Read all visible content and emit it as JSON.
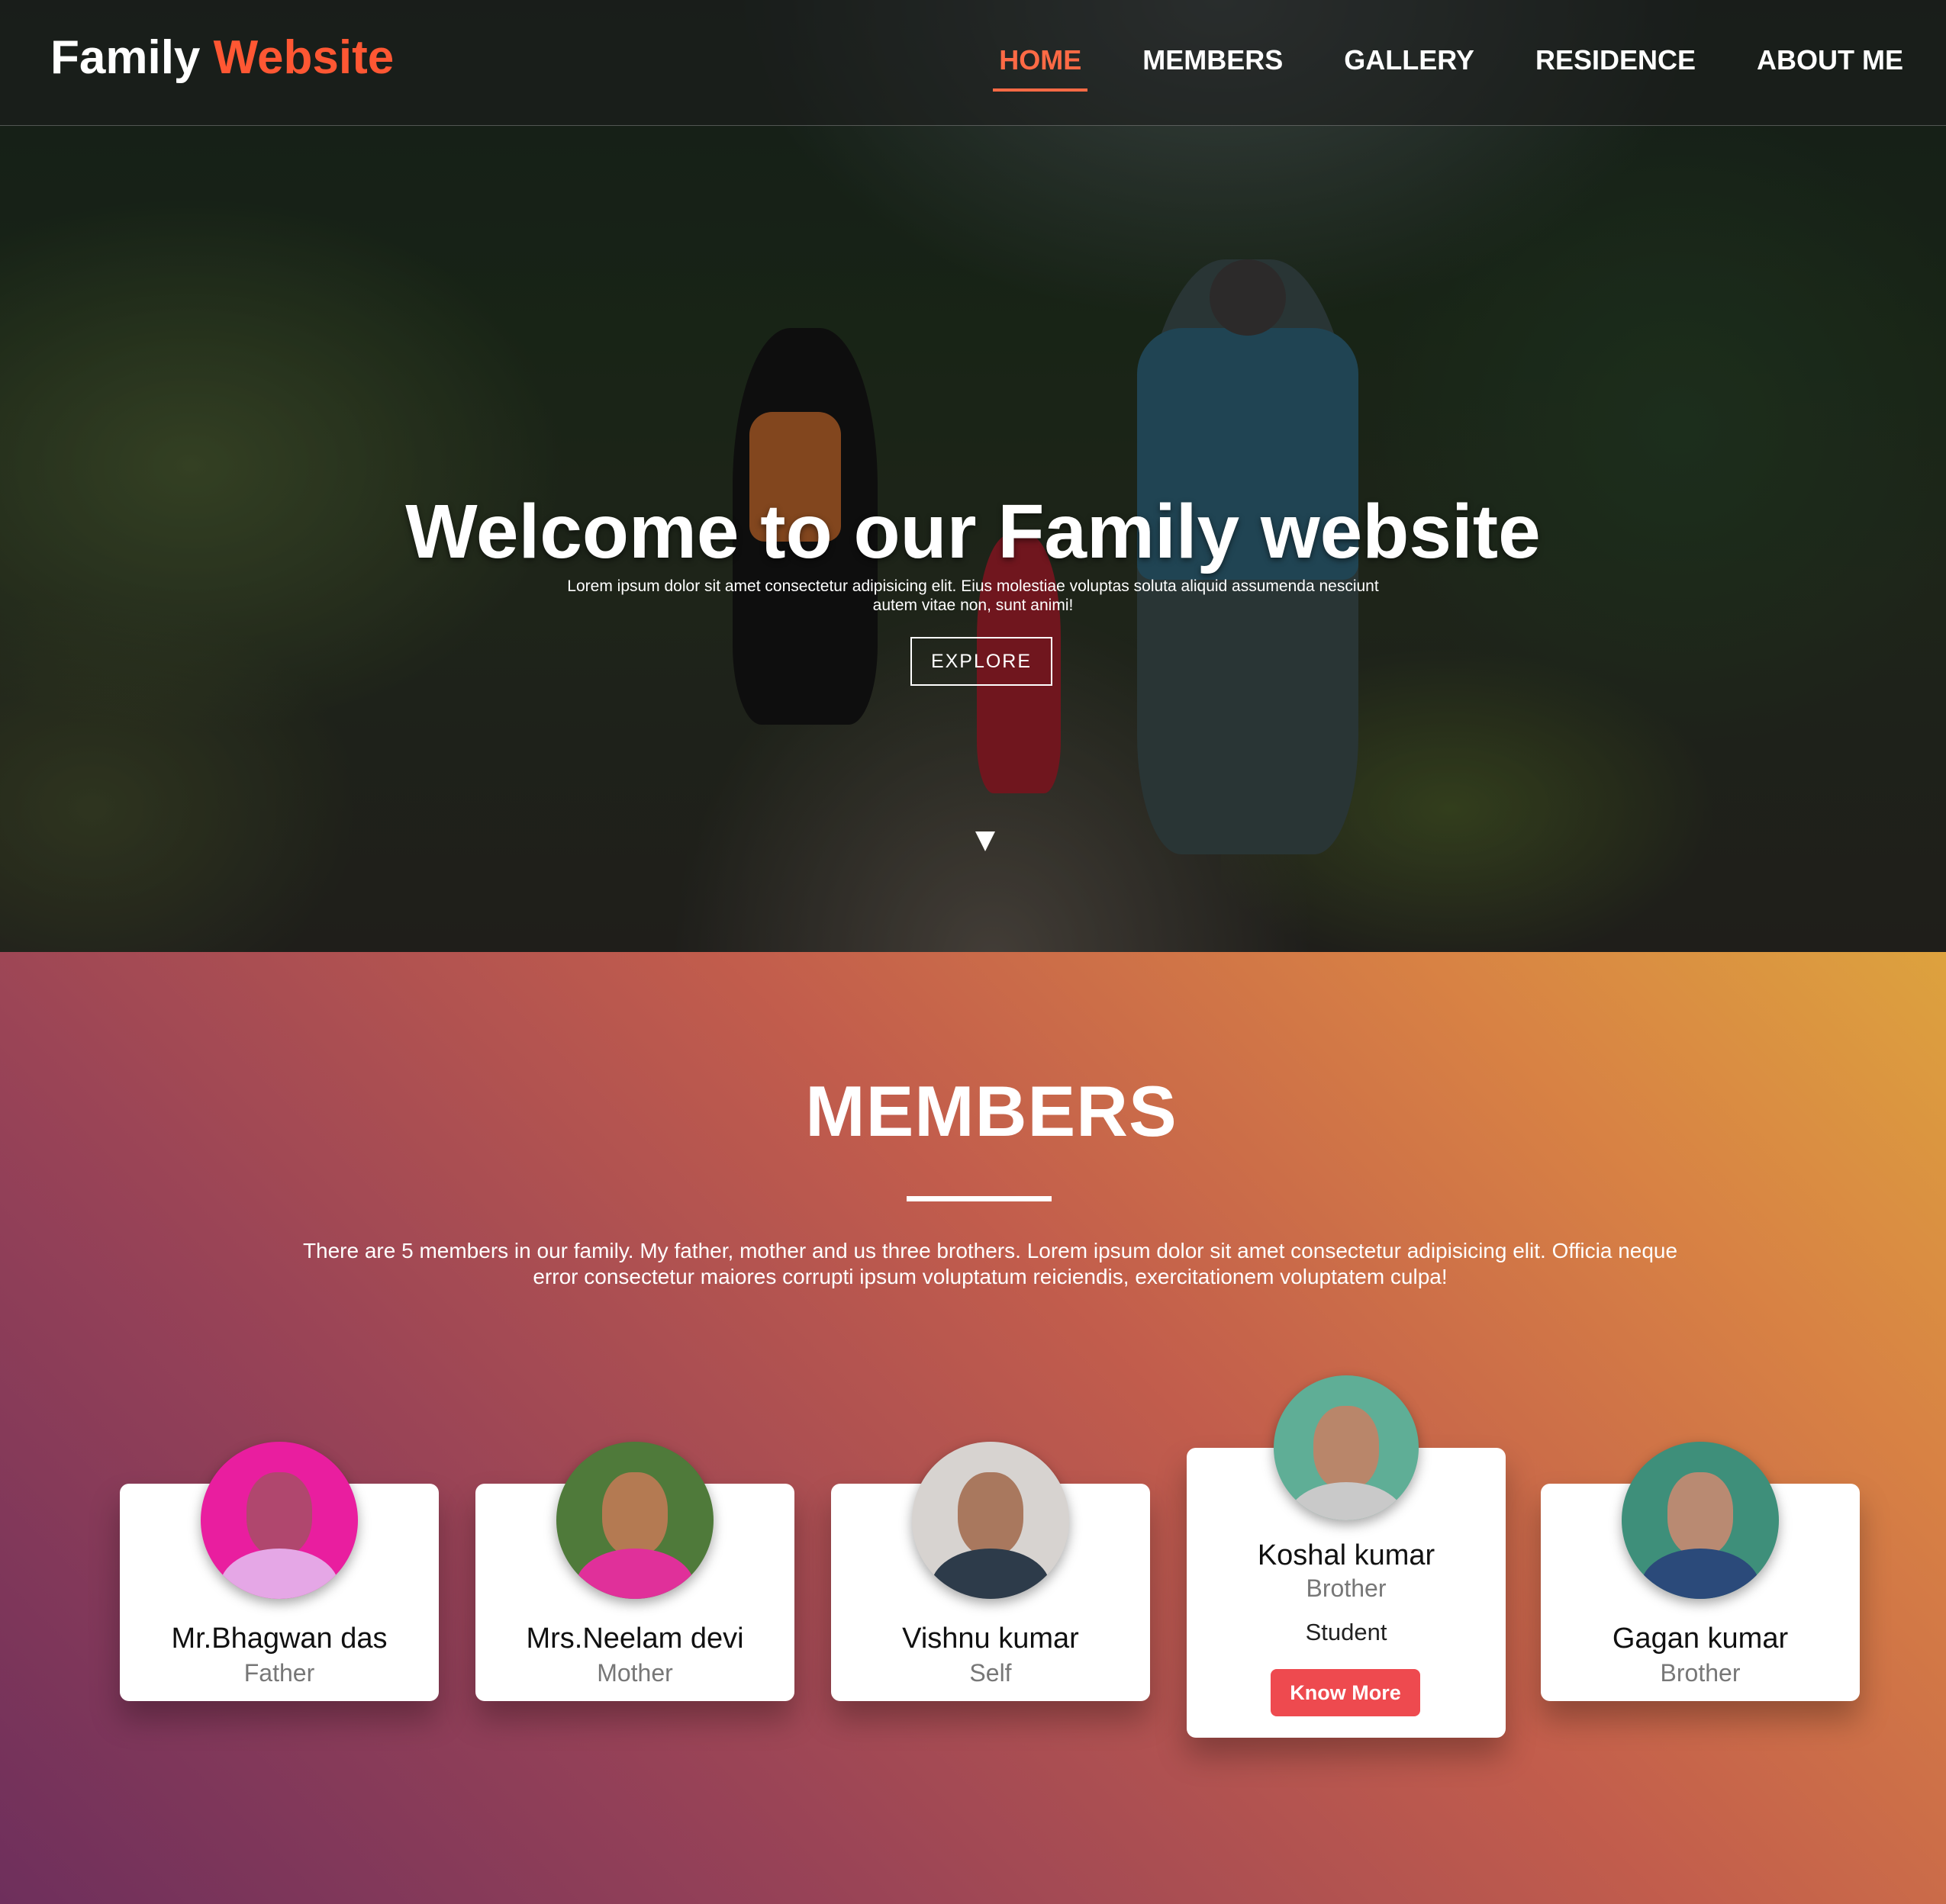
{
  "nav": {
    "logo_main": "Family",
    "logo_accent": "Website",
    "items": [
      {
        "label": "HOME",
        "active": true
      },
      {
        "label": "MEMBERS"
      },
      {
        "label": "GALLERY"
      },
      {
        "label": "RESIDENCE"
      },
      {
        "label": "ABOUT ME"
      }
    ]
  },
  "hero": {
    "title": "Welcome to our Family website",
    "subtitle": "Lorem ipsum dolor sit amet consectetur adipisicing elit. Eius molestiae voluptas soluta aliquid assumenda nesciunt autem vitae non, sunt animi!",
    "button": "EXPLORE",
    "scroll_icon": "triangle-down-icon"
  },
  "members": {
    "title": "MEMBERS",
    "description": "There are 5 members in our family. My father, mother and us three brothers. Lorem ipsum dolor sit amet consectetur adipisicing elit. Officia neque error consectetur maiores corrupti ipsum voluptatum reiciendis, exercitationem voluptatem culpa!",
    "cards": [
      {
        "name": "Mr.Bhagwan das",
        "role": "Father"
      },
      {
        "name": "Mrs.Neelam devi",
        "role": "Mother"
      },
      {
        "name": "Vishnu kumar",
        "role": "Self"
      },
      {
        "name": "Koshal kumar",
        "role": "Brother",
        "extra": "Student",
        "button": "Know More"
      },
      {
        "name": "Gagan kumar",
        "role": "Brother"
      }
    ]
  },
  "colors": {
    "accent": "#ff5733",
    "button_red": "#ee4a4f"
  }
}
